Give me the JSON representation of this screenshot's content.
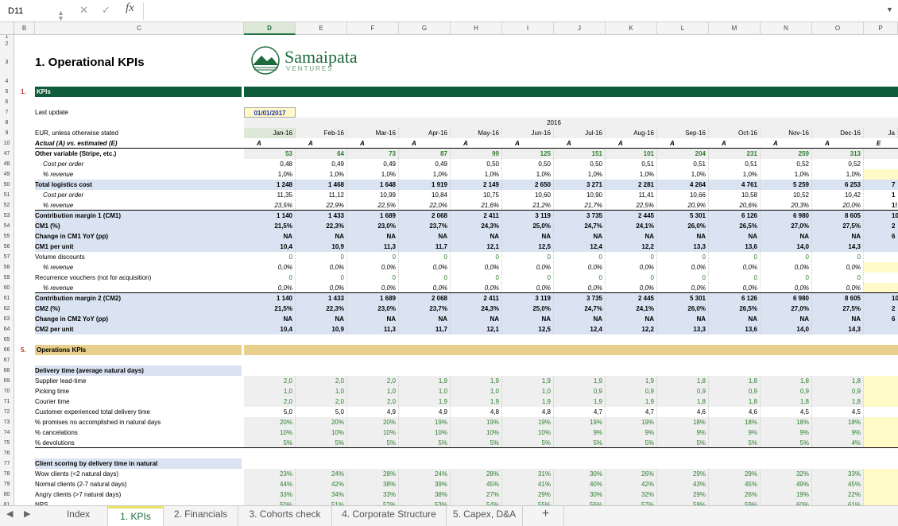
{
  "formula_bar": {
    "cell_ref": "D11",
    "fx": "fx",
    "cancel": "✕",
    "accept": "✓"
  },
  "columns": [
    "B",
    "C",
    "D",
    "E",
    "F",
    "G",
    "H",
    "I",
    "J",
    "K",
    "L",
    "M",
    "N",
    "O",
    "P"
  ],
  "selected_column": "D",
  "logo": {
    "name": "Samaipata",
    "sub": "VENTURES"
  },
  "colors": {
    "header_green": "#0f5c3a",
    "light_blue": "#dae3f1",
    "tan": "#e8cf8b",
    "yellow": "#fffac8",
    "value_green": "#2d7d2d",
    "tab_active": "#1e6b3a"
  },
  "rows": [
    {
      "n": "1",
      "type": "blank"
    },
    {
      "n": "2",
      "type": "blank"
    },
    {
      "n": "3",
      "type": "title",
      "label": "1. Operational KPIs"
    },
    {
      "n": "4",
      "type": "blank"
    },
    {
      "n": "5",
      "type": "section",
      "num": "1.",
      "label": "KPIs"
    },
    {
      "n": "6",
      "type": "blank"
    },
    {
      "n": "7",
      "type": "date",
      "label": "Last update",
      "value": "01/01/2017"
    },
    {
      "n": "8",
      "type": "year",
      "value": "2016"
    },
    {
      "n": "9",
      "type": "months",
      "label": "EUR, unless otherwise stated",
      "months": [
        "Jan-16",
        "Feb-16",
        "Mar-16",
        "Apr-16",
        "May-16",
        "Jun-16",
        "Jul-16",
        "Aug-16",
        "Sep-16",
        "Oct-16",
        "Nov-16",
        "Dec-16",
        "Ja"
      ]
    },
    {
      "n": "10",
      "type": "ae",
      "label": "Actual (A) vs. estimated (E)",
      "vals": [
        "A",
        "A",
        "A",
        "A",
        "A",
        "A",
        "A",
        "A",
        "A",
        "A",
        "A",
        "A",
        "E"
      ]
    },
    {
      "n": "47",
      "type": "data",
      "bold": true,
      "label": "Other variable (Stripe, etc.)",
      "green": true,
      "band": "grey",
      "vals": [
        "53",
        "64",
        "73",
        "87",
        "99",
        "125",
        "151",
        "101",
        "204",
        "231",
        "259",
        "313"
      ]
    },
    {
      "n": "48",
      "type": "data",
      "italic": true,
      "label": "Cost per order",
      "vals": [
        "0,48",
        "0,49",
        "0,49",
        "0,49",
        "0,50",
        "0,50",
        "0,50",
        "0,51",
        "0,51",
        "0,51",
        "0,52",
        "0,52"
      ]
    },
    {
      "n": "49",
      "type": "data",
      "italic": true,
      "label": "% revenue",
      "vals": [
        "1,0%",
        "1,0%",
        "1,0%",
        "1,0%",
        "1,0%",
        "1,0%",
        "1,0%",
        "1,0%",
        "1,0%",
        "1,0%",
        "1,0%",
        "1,0%"
      ],
      "ycell": true
    },
    {
      "n": "50",
      "type": "data",
      "bold": true,
      "label": "Total logistics cost",
      "band": "blue",
      "vals": [
        "1 248",
        "1 468",
        "1 648",
        "1 919",
        "2 149",
        "2 650",
        "3 271",
        "2 281",
        "4 264",
        "4 761",
        "5 259",
        "6 253"
      ],
      "tail": "7"
    },
    {
      "n": "51",
      "type": "data",
      "italic": true,
      "label": "Cost per order",
      "vals": [
        "11,35",
        "11,12",
        "10,99",
        "10,84",
        "10,75",
        "10,60",
        "10,90",
        "11,41",
        "10,66",
        "10,58",
        "10,52",
        "10,42"
      ],
      "tail": "1"
    },
    {
      "n": "52",
      "type": "data",
      "italic": true,
      "label": "% revenue",
      "uline": true,
      "valsItalic": true,
      "vals": [
        "23,5%",
        "22,9%",
        "22,5%",
        "22,0%",
        "21,6%",
        "21,2%",
        "21,7%",
        "22,5%",
        "20,9%",
        "20,6%",
        "20,3%",
        "20,0%"
      ],
      "tail": "1!"
    },
    {
      "n": "53",
      "type": "data",
      "bold": true,
      "label": "Contribution margin 1 (CM1)",
      "band": "blue",
      "vals": [
        "1 140",
        "1 433",
        "1 689",
        "2 068",
        "2 411",
        "3 119",
        "3 735",
        "2 445",
        "5 301",
        "6 126",
        "6 980",
        "8 605"
      ],
      "tail": "10"
    },
    {
      "n": "54",
      "type": "data",
      "bold": true,
      "label": "CM1 (%)",
      "band": "blue",
      "vals": [
        "21,5%",
        "22,3%",
        "23,0%",
        "23,7%",
        "24,3%",
        "25,0%",
        "24,7%",
        "24,1%",
        "26,0%",
        "26,5%",
        "27,0%",
        "27,5%"
      ],
      "tail": "2"
    },
    {
      "n": "55",
      "type": "data",
      "bold": true,
      "label": "Change in CM1 YoY (pp)",
      "band": "blue",
      "vals": [
        "NA",
        "NA",
        "NA",
        "NA",
        "NA",
        "NA",
        "NA",
        "NA",
        "NA",
        "NA",
        "NA",
        "NA"
      ],
      "tail": "6"
    },
    {
      "n": "56",
      "type": "data",
      "bold": true,
      "label": "CM1 per unit",
      "band": "blue",
      "vals": [
        "10,4",
        "10,9",
        "11,3",
        "11,7",
        "12,1",
        "12,5",
        "12,4",
        "12,2",
        "13,3",
        "13,6",
        "14,0",
        "14,3"
      ]
    },
    {
      "n": "57",
      "type": "data",
      "label": "Volume discounts",
      "green": true,
      "vals": [
        "0",
        "0",
        "0",
        "0",
        "0",
        "0",
        "0",
        "0",
        "0",
        "0",
        "0",
        "0"
      ]
    },
    {
      "n": "58",
      "type": "data",
      "italic": true,
      "label": "% revenue",
      "valsItalic": true,
      "vals": [
        "0,0%",
        "0,0%",
        "0,0%",
        "0,0%",
        "0,0%",
        "0,0%",
        "0,0%",
        "0,0%",
        "0,0%",
        "0,0%",
        "0,0%",
        "0,0%"
      ],
      "ycell": true
    },
    {
      "n": "59",
      "type": "data",
      "label": "Recurrence vouchers (not for acquisition)",
      "green": true,
      "vals": [
        "0",
        "0",
        "0",
        "0",
        "0",
        "0",
        "0",
        "0",
        "0",
        "0",
        "0",
        "0"
      ]
    },
    {
      "n": "60",
      "type": "data",
      "italic": true,
      "label": "% revenue",
      "uline": true,
      "valsItalic": true,
      "vals": [
        "0,0%",
        "0,0%",
        "0,0%",
        "0,0%",
        "0,0%",
        "0,0%",
        "0,0%",
        "0,0%",
        "0,0%",
        "0,0%",
        "0,0%",
        "0,0%"
      ],
      "ycell": true
    },
    {
      "n": "61",
      "type": "data",
      "bold": true,
      "label": "Contribution margin 2 (CM2)",
      "band": "blue",
      "vals": [
        "1 140",
        "1 433",
        "1 689",
        "2 068",
        "2 411",
        "3 119",
        "3 735",
        "2 445",
        "5 301",
        "6 126",
        "6 980",
        "8 605"
      ],
      "tail": "10"
    },
    {
      "n": "62",
      "type": "data",
      "bold": true,
      "label": "CM2 (%)",
      "band": "blue",
      "vals": [
        "21,5%",
        "22,3%",
        "23,0%",
        "23,7%",
        "24,3%",
        "25,0%",
        "24,7%",
        "24,1%",
        "26,0%",
        "26,5%",
        "27,0%",
        "27,5%"
      ],
      "tail": "2"
    },
    {
      "n": "63",
      "type": "data",
      "bold": true,
      "label": "Change in CM2 YoY (pp)",
      "band": "blue",
      "vals": [
        "NA",
        "NA",
        "NA",
        "NA",
        "NA",
        "NA",
        "NA",
        "NA",
        "NA",
        "NA",
        "NA",
        "NA"
      ],
      "tail": "6"
    },
    {
      "n": "64",
      "type": "data",
      "bold": true,
      "label": "CM2 per unit",
      "band": "blue",
      "vals": [
        "10,4",
        "10,9",
        "11,3",
        "11,7",
        "12,1",
        "12,5",
        "12,4",
        "12,2",
        "13,3",
        "13,6",
        "14,0",
        "14,3"
      ]
    },
    {
      "n": "65",
      "type": "blank"
    },
    {
      "n": "66",
      "type": "section2",
      "num": "5.",
      "label": "Operations KPIs"
    },
    {
      "n": "67",
      "type": "blank"
    },
    {
      "n": "68",
      "type": "subhead",
      "label": "Delivery time (average natural days)"
    },
    {
      "n": "69",
      "type": "data",
      "label": "Supplier lead-time",
      "green": true,
      "band": "grey",
      "vals": [
        "2,0",
        "2,0",
        "2,0",
        "1,9",
        "1,9",
        "1,9",
        "1,9",
        "1,9",
        "1,8",
        "1,8",
        "1,8",
        "1,8"
      ],
      "ycell": true
    },
    {
      "n": "70",
      "type": "data",
      "label": "Picking time",
      "green": true,
      "band": "grey",
      "vals": [
        "1,0",
        "1,0",
        "1,0",
        "1,0",
        "1,0",
        "1,0",
        "0,9",
        "0,9",
        "0,9",
        "0,9",
        "0,9",
        "0,9"
      ],
      "ycell": true
    },
    {
      "n": "71",
      "type": "data",
      "label": "Courier time",
      "green": true,
      "band": "grey",
      "vals": [
        "2,0",
        "2,0",
        "2,0",
        "1,9",
        "1,9",
        "1,9",
        "1,9",
        "1,9",
        "1,8",
        "1,8",
        "1,8",
        "1,8"
      ],
      "ycell": true
    },
    {
      "n": "72",
      "type": "data",
      "label": "Customer experienced total delivery time",
      "vals": [
        "5,0",
        "5,0",
        "4,9",
        "4,9",
        "4,8",
        "4,8",
        "4,7",
        "4,7",
        "4,6",
        "4,6",
        "4,5",
        "4,5"
      ]
    },
    {
      "n": "73",
      "type": "data",
      "label": "% promises no accomplished in natural days",
      "green": true,
      "band": "grey",
      "vals": [
        "20%",
        "20%",
        "20%",
        "19%",
        "19%",
        "19%",
        "19%",
        "19%",
        "18%",
        "18%",
        "18%",
        "18%"
      ],
      "ycell": true
    },
    {
      "n": "74",
      "type": "data",
      "label": "% cancelations",
      "green": true,
      "band": "grey",
      "vals": [
        "10%",
        "10%",
        "10%",
        "10%",
        "10%",
        "10%",
        "9%",
        "9%",
        "9%",
        "9%",
        "9%",
        "9%"
      ],
      "ycell": true
    },
    {
      "n": "75",
      "type": "data",
      "label": "% devolutions",
      "green": true,
      "band": "grey",
      "uline": true,
      "vals": [
        "5%",
        "5%",
        "5%",
        "5%",
        "5%",
        "5%",
        "5%",
        "5%",
        "5%",
        "5%",
        "5%",
        "4%"
      ],
      "ycell": true
    },
    {
      "n": "76",
      "type": "blank"
    },
    {
      "n": "77",
      "type": "subhead",
      "label": "Client scoring by delivery time in natural"
    },
    {
      "n": "78",
      "type": "data",
      "label": "Wow clients (<2 natural days)",
      "green": true,
      "band": "grey",
      "vals": [
        "23%",
        "24%",
        "28%",
        "24%",
        "28%",
        "31%",
        "30%",
        "26%",
        "29%",
        "29%",
        "32%",
        "33%"
      ],
      "ycell": true
    },
    {
      "n": "79",
      "type": "data",
      "label": "Normal clients (2-7 natural days)",
      "green": true,
      "band": "grey",
      "vals": [
        "44%",
        "42%",
        "38%",
        "39%",
        "45%",
        "41%",
        "40%",
        "42%",
        "43%",
        "45%",
        "49%",
        "45%"
      ],
      "ycell": true
    },
    {
      "n": "80",
      "type": "data",
      "label": "Angry clients (>7 natural days)",
      "green": true,
      "band": "grey",
      "vals": [
        "33%",
        "34%",
        "33%",
        "38%",
        "27%",
        "29%",
        "30%",
        "32%",
        "29%",
        "26%",
        "19%",
        "22%"
      ],
      "ycell": true
    },
    {
      "n": "81",
      "type": "data",
      "label": "NPS",
      "green": true,
      "band": "grey",
      "vals": [
        "50%",
        "51%",
        "52%",
        "53%",
        "54%",
        "55%",
        "56%",
        "57%",
        "58%",
        "59%",
        "60%",
        "61%"
      ],
      "ycell": true
    },
    {
      "n": "82",
      "type": "blank"
    }
  ],
  "tabs": [
    {
      "label": "Index",
      "active": false
    },
    {
      "label": "1. KPIs",
      "active": true
    },
    {
      "label": "2. Financials",
      "active": false
    },
    {
      "label": "3. Cohorts check",
      "active": false
    },
    {
      "label": "4. Corporate Structure",
      "active": false
    },
    {
      "label": "5. Capex, D&A",
      "active": false
    }
  ],
  "add_tab": "+"
}
